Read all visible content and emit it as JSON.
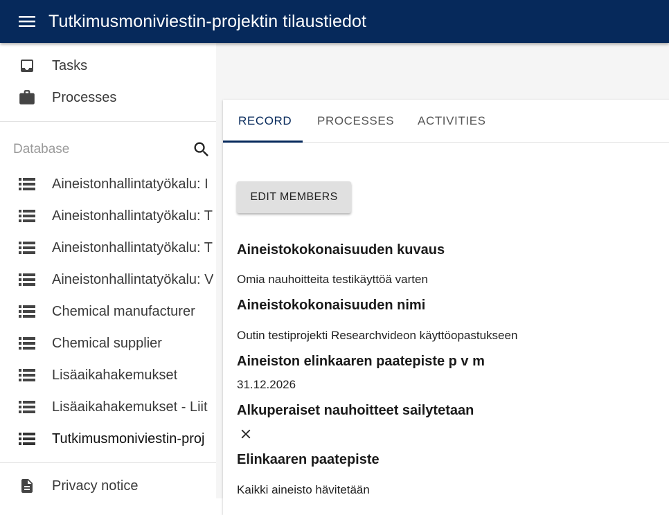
{
  "appbar": {
    "title": "Tutkimusmoniviestin-projektin tilaustiedot",
    "menu_icon": "hamburger-menu-icon"
  },
  "sidebar": {
    "top_items": [
      {
        "label": "Tasks",
        "icon": "inbox-icon"
      },
      {
        "label": "Processes",
        "icon": "briefcase-icon"
      }
    ],
    "database_label": "Database",
    "database_items": [
      {
        "label": "Aineistonhallintatyökalu: I",
        "icon": "list-icon"
      },
      {
        "label": "Aineistonhallintatyökalu: T",
        "icon": "list-icon"
      },
      {
        "label": "Aineistonhallintatyökalu: T",
        "icon": "list-icon"
      },
      {
        "label": "Aineistonhallintatyökalu: V",
        "icon": "list-icon"
      },
      {
        "label": "Chemical manufacturer",
        "icon": "list-icon"
      },
      {
        "label": "Chemical supplier",
        "icon": "list-icon"
      },
      {
        "label": "Lisäaikahakemukset",
        "icon": "list-icon"
      },
      {
        "label": "Lisäaikahakemukset - Liit",
        "icon": "list-icon"
      },
      {
        "label": "Tutkimusmoniviestin-proj",
        "icon": "list-icon",
        "selected": true
      }
    ],
    "bottom_items": [
      {
        "label": "Privacy notice",
        "icon": "document-icon"
      }
    ]
  },
  "tabs": [
    {
      "label": "RECORD",
      "active": true
    },
    {
      "label": "PROCESSES",
      "active": false
    },
    {
      "label": "ACTIVITIES",
      "active": false
    }
  ],
  "record": {
    "edit_members_label": "EDIT MEMBERS",
    "fields": [
      {
        "label": "Aineistokokonaisuuden kuvaus",
        "value": "Omia nauhoitteita testikäyttöä varten"
      },
      {
        "label": "Aineistokokonaisuuden nimi",
        "value": "Outin testiprojekti Researchvideon käyttöopastukseen"
      },
      {
        "label": "Aineiston elinkaaren paatepiste p v m",
        "value": "31.12.2026"
      },
      {
        "label": "Alkuperaiset nauhoitteet sailytetaan",
        "value_icon": "close-icon"
      },
      {
        "label": "Elinkaaren paatepiste",
        "value": "Kaikki aineisto hävitetään"
      }
    ]
  },
  "colors": {
    "appbar": "#06295b",
    "accent": "#06295b"
  }
}
